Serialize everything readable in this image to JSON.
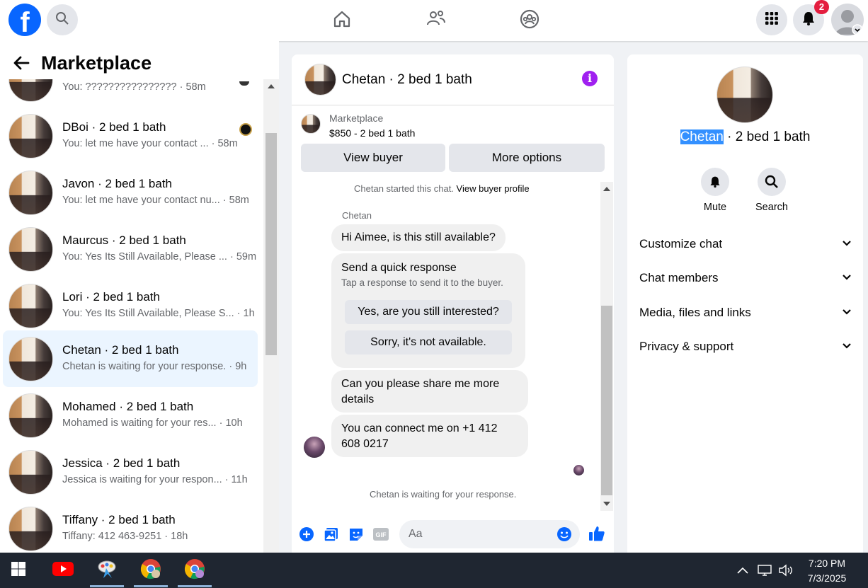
{
  "header": {
    "logo_text": "f",
    "notifications_count": "2",
    "icons": [
      "search-icon",
      "home-icon",
      "friends-icon",
      "groups-icon",
      "menu-grid-icon",
      "bell-icon",
      "profile-avatar"
    ]
  },
  "left": {
    "title": "Marketplace",
    "conversations": [
      {
        "name": "",
        "preview": "You: ???????????????? · 58m",
        "partial": true
      },
      {
        "name": "DBoi · 2 bed 1 bath",
        "preview": "You: let me have your contact ... · 58m"
      },
      {
        "name": "Javon · 2 bed 1 bath",
        "preview": "You: let me have your contact nu... · 58m"
      },
      {
        "name": "Maurcus · 2 bed 1 bath",
        "preview": "You: Yes Its Still Available, Please ... · 59m"
      },
      {
        "name": "Lori · 2 bed 1 bath",
        "preview": "You: Yes Its Still Available, Please S... · 1h"
      },
      {
        "name": "Chetan · 2 bed 1 bath",
        "preview": "Chetan is waiting for your response. · 9h",
        "active": true
      },
      {
        "name": "Mohamed · 2 bed 1 bath",
        "preview": "Mohamed is waiting for your res... · 10h"
      },
      {
        "name": "Jessica · 2 bed 1 bath",
        "preview": "Jessica is waiting for your respon... · 11h"
      },
      {
        "name": "Tiffany · 2 bed 1 bath",
        "preview": "Tiffany: 412 463-9251 · 18h"
      }
    ]
  },
  "chat": {
    "title": "Chetan · 2 bed 1 bath",
    "marketplace_label": "Marketplace",
    "listing": "$850 - 2 bed 1 bath",
    "view_buyer": "View buyer",
    "more_options": "More options",
    "started_text": "Chetan started this chat.",
    "view_profile": "View buyer profile",
    "sender_name": "Chetan",
    "msg1": "Hi Aimee, is this still available?",
    "quick_title": "Send a quick response",
    "quick_sub": "Tap a response to send it to the buyer.",
    "quick1": "Yes, are you still interested?",
    "quick2": "Sorry, it's not available.",
    "msg2_line1": "Can you please share me more",
    "msg2_line2": "details",
    "msg3_line1": "You can connect me on +1 412",
    "msg3_line2": "608 0217",
    "waiting": "Chetan is waiting for your response.",
    "input_placeholder": "Aa"
  },
  "right": {
    "name_highlight": "Chetan",
    "name_rest": " · 2 bed 1 bath",
    "mute": "Mute",
    "search": "Search",
    "sections": [
      "Customize chat",
      "Chat members",
      "Media, files and links",
      "Privacy & support"
    ]
  },
  "taskbar": {
    "time": "7:20 PM",
    "date": "7/3/2025"
  },
  "colors": {
    "accent": "#0866ff",
    "active_row": "#ebf5ff",
    "badge": "#e41e3f",
    "info": "#a020f0",
    "taskbar": "#1f2631"
  }
}
